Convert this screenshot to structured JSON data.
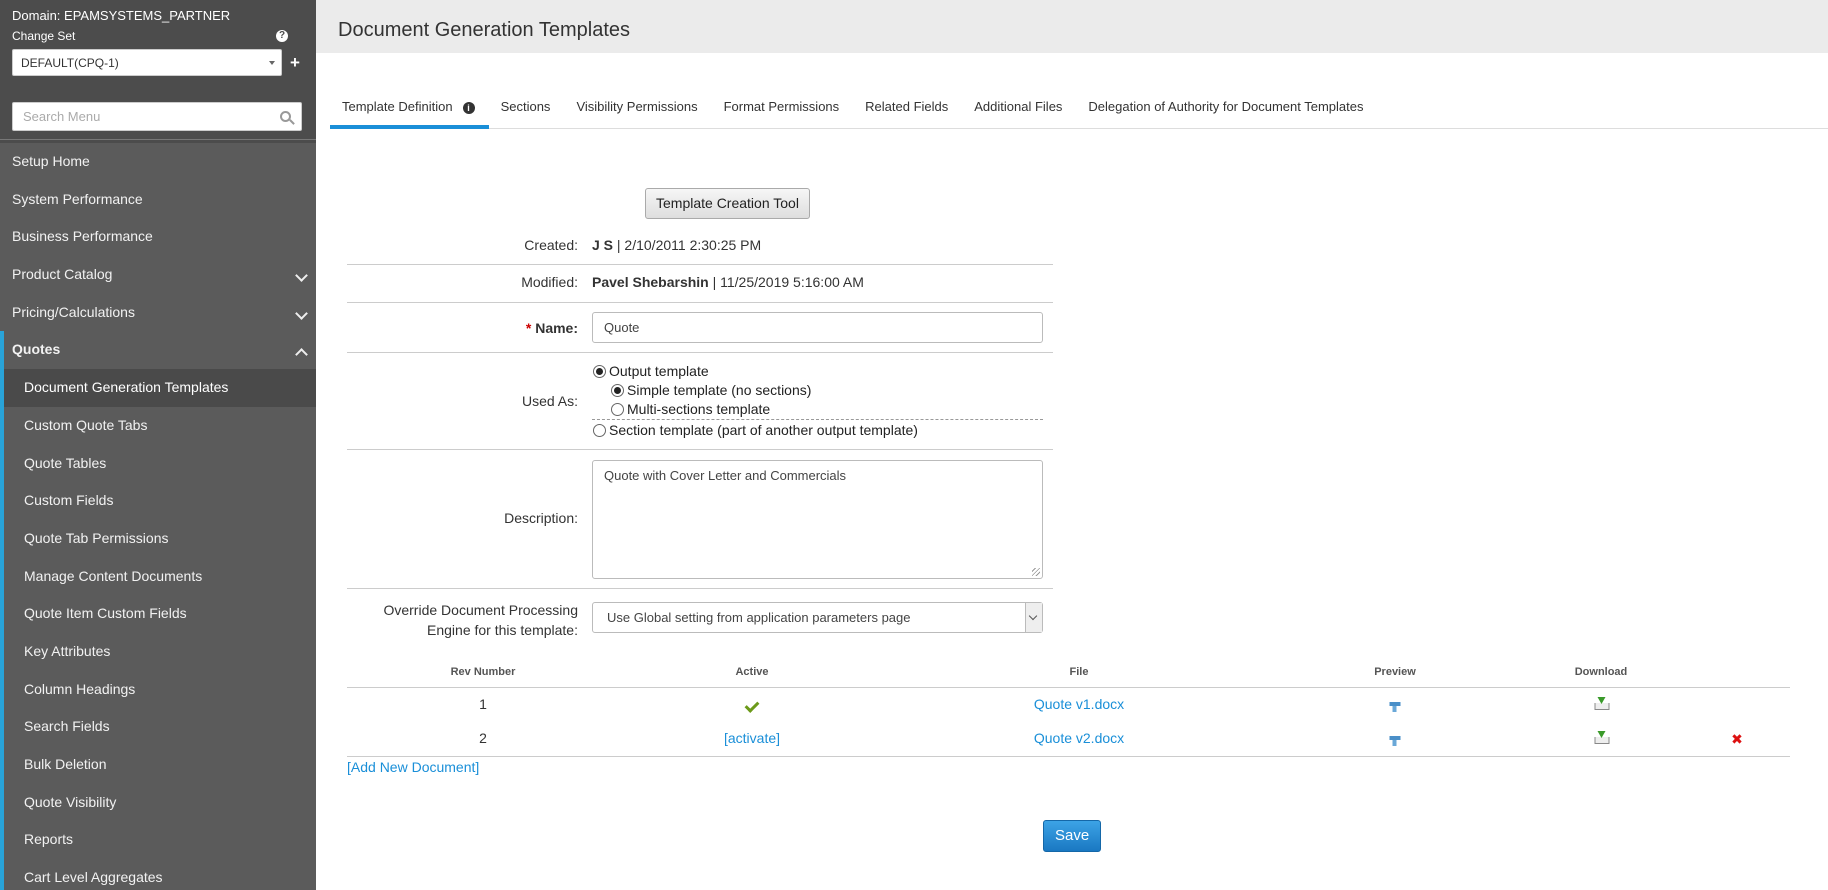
{
  "sidebar": {
    "domain": "Domain: EPAMSYSTEMS_PARTNER",
    "change_set_label": "Change Set",
    "change_set_value": "DEFAULT(CPQ-1)",
    "search_placeholder": "Search Menu",
    "items": [
      {
        "label": "Setup Home"
      },
      {
        "label": "System Performance"
      },
      {
        "label": "Business Performance"
      },
      {
        "label": "Product Catalog"
      },
      {
        "label": "Pricing/Calculations"
      },
      {
        "label": "Quotes"
      }
    ],
    "sub_items": [
      {
        "label": "Document Generation Templates"
      },
      {
        "label": "Custom Quote Tabs"
      },
      {
        "label": "Quote Tables"
      },
      {
        "label": "Custom Fields"
      },
      {
        "label": "Quote Tab Permissions"
      },
      {
        "label": "Manage Content Documents"
      },
      {
        "label": "Quote Item Custom Fields"
      },
      {
        "label": "Key Attributes"
      },
      {
        "label": "Column Headings"
      },
      {
        "label": "Search Fields"
      },
      {
        "label": "Bulk Deletion"
      },
      {
        "label": "Quote Visibility"
      },
      {
        "label": "Reports"
      },
      {
        "label": "Cart Level Aggregates"
      }
    ]
  },
  "header": {
    "title": "Document Generation Templates"
  },
  "tabs": [
    {
      "label": "Template Definition"
    },
    {
      "label": "Sections"
    },
    {
      "label": "Visibility Permissions"
    },
    {
      "label": "Format Permissions"
    },
    {
      "label": "Related Fields"
    },
    {
      "label": "Additional Files"
    },
    {
      "label": "Delegation of Authority for Document Templates"
    }
  ],
  "form": {
    "tool_button": "Template Creation Tool",
    "created_label": "Created:",
    "created_user": "J S",
    "created_date": " | 2/10/2011 2:30:25 PM",
    "modified_label": "Modified:",
    "modified_user": "Pavel Shebarshin",
    "modified_date": " | 11/25/2019 5:16:00 AM",
    "name_required": "* ",
    "name_label": "Name:",
    "name_value": "Quote",
    "used_as_label": "Used As:",
    "opt_output": "Output template",
    "opt_simple": "Simple template (no sections)",
    "opt_multi": "Multi-sections template",
    "opt_section": "Section template (part of another output template)",
    "description_label": "Description:",
    "description_value": "Quote with Cover Letter and Commercials",
    "override_label_1": "Override Document Processing",
    "override_label_2": "Engine for this template:",
    "override_value": "Use Global setting from application parameters page"
  },
  "documents": {
    "headers": {
      "rev": "Rev Number",
      "active": "Active",
      "file": "File",
      "preview": "Preview",
      "download": "Download"
    },
    "rows": [
      {
        "rev": "1",
        "active": "",
        "file": "Quote v1.docx"
      },
      {
        "rev": "2",
        "active": "[activate]",
        "file": "Quote v2.docx"
      }
    ],
    "add_link": "[Add New Document]"
  },
  "save_label": "Save"
}
